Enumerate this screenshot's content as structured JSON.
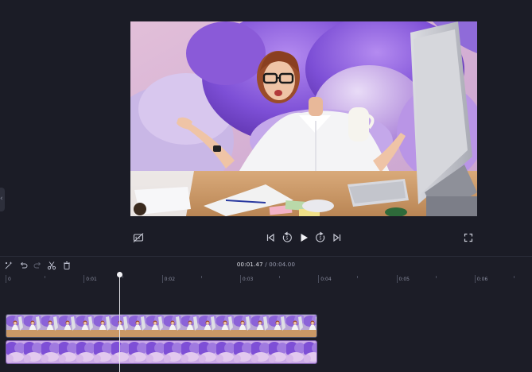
{
  "player": {
    "current_time": "00:01.47",
    "separator": " / ",
    "total_time": "00:04.00"
  },
  "ruler": {
    "labels": [
      "0",
      "0:01",
      "0:02",
      "0:03",
      "0:04",
      "0:05",
      "0:06"
    ]
  },
  "icons": {
    "caption": "caption-off-icon",
    "skip_back": "skip-to-start-icon",
    "rewind": "rewind-5s-icon",
    "play": "play-icon",
    "forward": "forward-5s-icon",
    "skip_forward": "skip-to-end-icon",
    "fullscreen": "fullscreen-icon",
    "magic": "magic-wand-icon",
    "undo": "undo-icon",
    "redo": "redo-icon",
    "split": "scissors-icon",
    "delete": "trash-icon"
  },
  "colors": {
    "background": "#1c1d27",
    "bg_track": "#4b2a6e",
    "video_track": "#2e3142",
    "playhead": "#e8e8ee"
  }
}
